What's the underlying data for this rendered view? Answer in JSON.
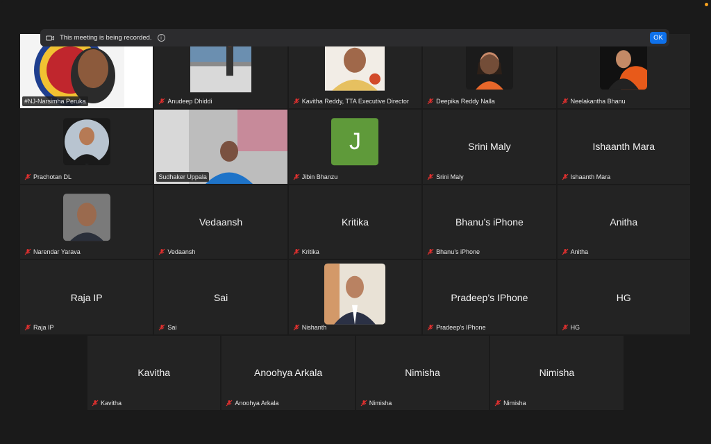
{
  "banner": {
    "text": "This meeting is being recorded.",
    "ok_label": "OK"
  },
  "colors": {
    "ok_button": "#0e71eb",
    "tile_bg": "#232323",
    "mute": "#e0302f",
    "J_avatar": "#5f9a3a"
  },
  "participants": [
    {
      "label": "#NJ-Narsimha Peruka",
      "big": "",
      "muted": false
    },
    {
      "label": "Anudeep Dhiddi",
      "big": "",
      "muted": true
    },
    {
      "label": "Kavitha Reddy, TTA Executive Director",
      "big": "",
      "muted": true
    },
    {
      "label": "Deepika Reddy Nalla",
      "big": "",
      "muted": true
    },
    {
      "label": "Neelakantha Bhanu",
      "big": "",
      "muted": true
    },
    {
      "label": "Prachotan DL",
      "big": "",
      "muted": true
    },
    {
      "label": "Sudhaker Uppala",
      "big": "",
      "muted": false
    },
    {
      "label": "Jibin Bhanzu",
      "big": "J",
      "muted": true
    },
    {
      "label": "Srini Maly",
      "big": "Srini Maly",
      "muted": true
    },
    {
      "label": "Ishaanth Mara",
      "big": "Ishaanth Mara",
      "muted": true
    },
    {
      "label": "Narendar Yarava",
      "big": "",
      "muted": true
    },
    {
      "label": "Vedaansh",
      "big": "Vedaansh",
      "muted": true
    },
    {
      "label": "Kritika",
      "big": "Kritika",
      "muted": true
    },
    {
      "label": "Bhanu’s iPhone",
      "big": "Bhanu’s iPhone",
      "muted": true
    },
    {
      "label": "Anitha",
      "big": "Anitha",
      "muted": true
    },
    {
      "label": "Raja IP",
      "big": "Raja IP",
      "muted": true
    },
    {
      "label": "Sai",
      "big": "Sai",
      "muted": true
    },
    {
      "label": "Nishanth",
      "big": "",
      "muted": true
    },
    {
      "label": "Pradeep’s IPhone",
      "big": "Pradeep’s IPhone",
      "muted": true
    },
    {
      "label": "HG",
      "big": "HG",
      "muted": true
    },
    {
      "label": "Kavitha",
      "big": "Kavitha",
      "muted": true
    },
    {
      "label": "Anoohya Arkala",
      "big": "Anoohya Arkala",
      "muted": true
    },
    {
      "label": "Nimisha",
      "big": "Nimisha",
      "muted": true
    },
    {
      "label": "Nimisha",
      "big": "Nimisha",
      "muted": true
    }
  ]
}
